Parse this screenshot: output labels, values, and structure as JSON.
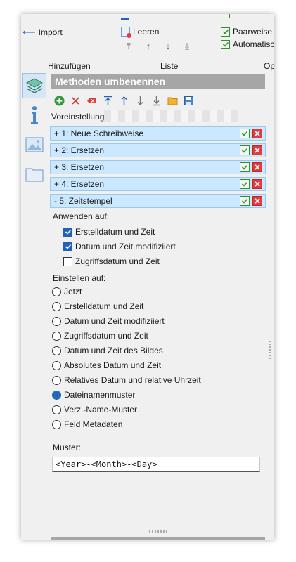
{
  "toolbar": {
    "import_label": "Import",
    "clear_label": "Leeren",
    "pairwise_label": "Paarweise U",
    "automatic_label": "Automatisc",
    "group_add": "Hinzufügen",
    "group_list": "Liste",
    "group_options": "Op"
  },
  "panel": {
    "title": "Methoden umbenennen",
    "presets_label": "Voreinstellungen"
  },
  "methods": [
    {
      "label": "+ 1: Neue Schreibweise"
    },
    {
      "label": "+ 2: Ersetzen"
    },
    {
      "label": "+ 3: Ersetzen"
    },
    {
      "label": "+ 4: Ersetzen"
    },
    {
      "label": "-  5: Zeitstempel"
    }
  ],
  "apply_to": {
    "label": "Anwenden auf:",
    "options": [
      {
        "label": "Erstelldatum und Zeit",
        "checked": true
      },
      {
        "label": "Datum und Zeit modifiziiert",
        "checked": true
      },
      {
        "label": "Zugriffsdatum und Zeit",
        "checked": false
      }
    ]
  },
  "set_to": {
    "label": "Einstellen auf:",
    "options": [
      {
        "label": "Jetzt",
        "selected": false
      },
      {
        "label": "Erstelldatum und Zeit",
        "selected": false
      },
      {
        "label": "Datum und Zeit modifiziiert",
        "selected": false
      },
      {
        "label": "Zugriffsdatum und Zeit",
        "selected": false
      },
      {
        "label": "Datum und Zeit des Bildes",
        "selected": false
      },
      {
        "label": "Absolutes Datum und Zeit",
        "selected": false
      },
      {
        "label": "Relatives Datum und relative Uhrzeit",
        "selected": false
      },
      {
        "label": "Dateinamenmuster",
        "selected": true
      },
      {
        "label": "Verz.-Name-Muster",
        "selected": false
      },
      {
        "label": "Feld Metadaten",
        "selected": false
      }
    ]
  },
  "pattern": {
    "label": "Muster:",
    "value": "<Year>-<Month>-<Day>"
  },
  "colors": {
    "accent": "#1f63b5",
    "row_bg": "#cce8ff",
    "title_bg": "#a6a6a6",
    "delete_red": "#e03c3c",
    "ok_green": "#3a8a3a"
  }
}
